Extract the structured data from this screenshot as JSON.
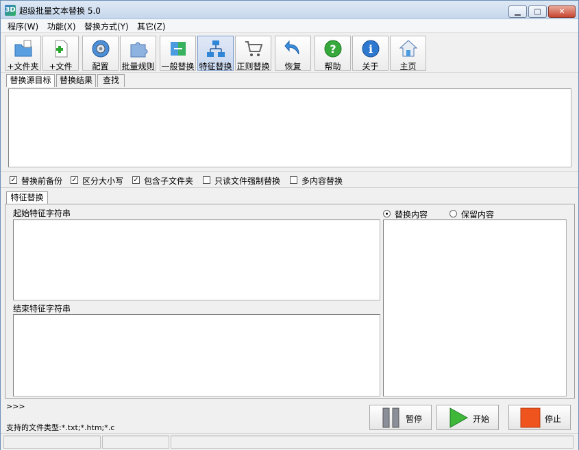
{
  "window": {
    "title": "超级批量文本替换 5.0",
    "icon": "3D"
  },
  "menu": [
    "程序(W)",
    "功能(X)",
    "替换方式(Y)",
    "其它(Z)"
  ],
  "toolbar": [
    {
      "label": "+文件夹",
      "icon": "folder-add-icon"
    },
    {
      "label": "+文件",
      "icon": "file-add-icon"
    },
    {
      "label": "配置",
      "icon": "gear-icon"
    },
    {
      "label": "批量规则",
      "icon": "puzzle-icon"
    },
    {
      "label": "一般替换",
      "icon": "swap-icon"
    },
    {
      "label": "特征替换",
      "icon": "network-icon"
    },
    {
      "label": "正则替换",
      "icon": "cart-icon"
    },
    {
      "label": "恢复",
      "icon": "undo-icon"
    },
    {
      "label": "帮助",
      "icon": "help-icon"
    },
    {
      "label": "关于",
      "icon": "info-icon"
    },
    {
      "label": "主页",
      "icon": "home-icon"
    }
  ],
  "tabs": [
    "替换源目标",
    "替换结果",
    "查找"
  ],
  "options": [
    {
      "label": "替换前备份",
      "checked": true
    },
    {
      "label": "区分大小写",
      "checked": true
    },
    {
      "label": "包含子文件夹",
      "checked": true
    },
    {
      "label": "只读文件强制替换",
      "checked": false
    },
    {
      "label": "多内容替换",
      "checked": false
    }
  ],
  "feature_tab": "特征替换",
  "start_label": "起始特征字符串",
  "end_label": "结束特征字符串",
  "radios": [
    {
      "label": "替换内容",
      "selected": true
    },
    {
      "label": "保留内容",
      "selected": false
    }
  ],
  "log": {
    "prompt": ">>>",
    "supported": "支持的文件类型:*.txt;*.htm;*.c"
  },
  "actions": {
    "pause": "暂停",
    "start": "开始",
    "stop": "停止"
  }
}
